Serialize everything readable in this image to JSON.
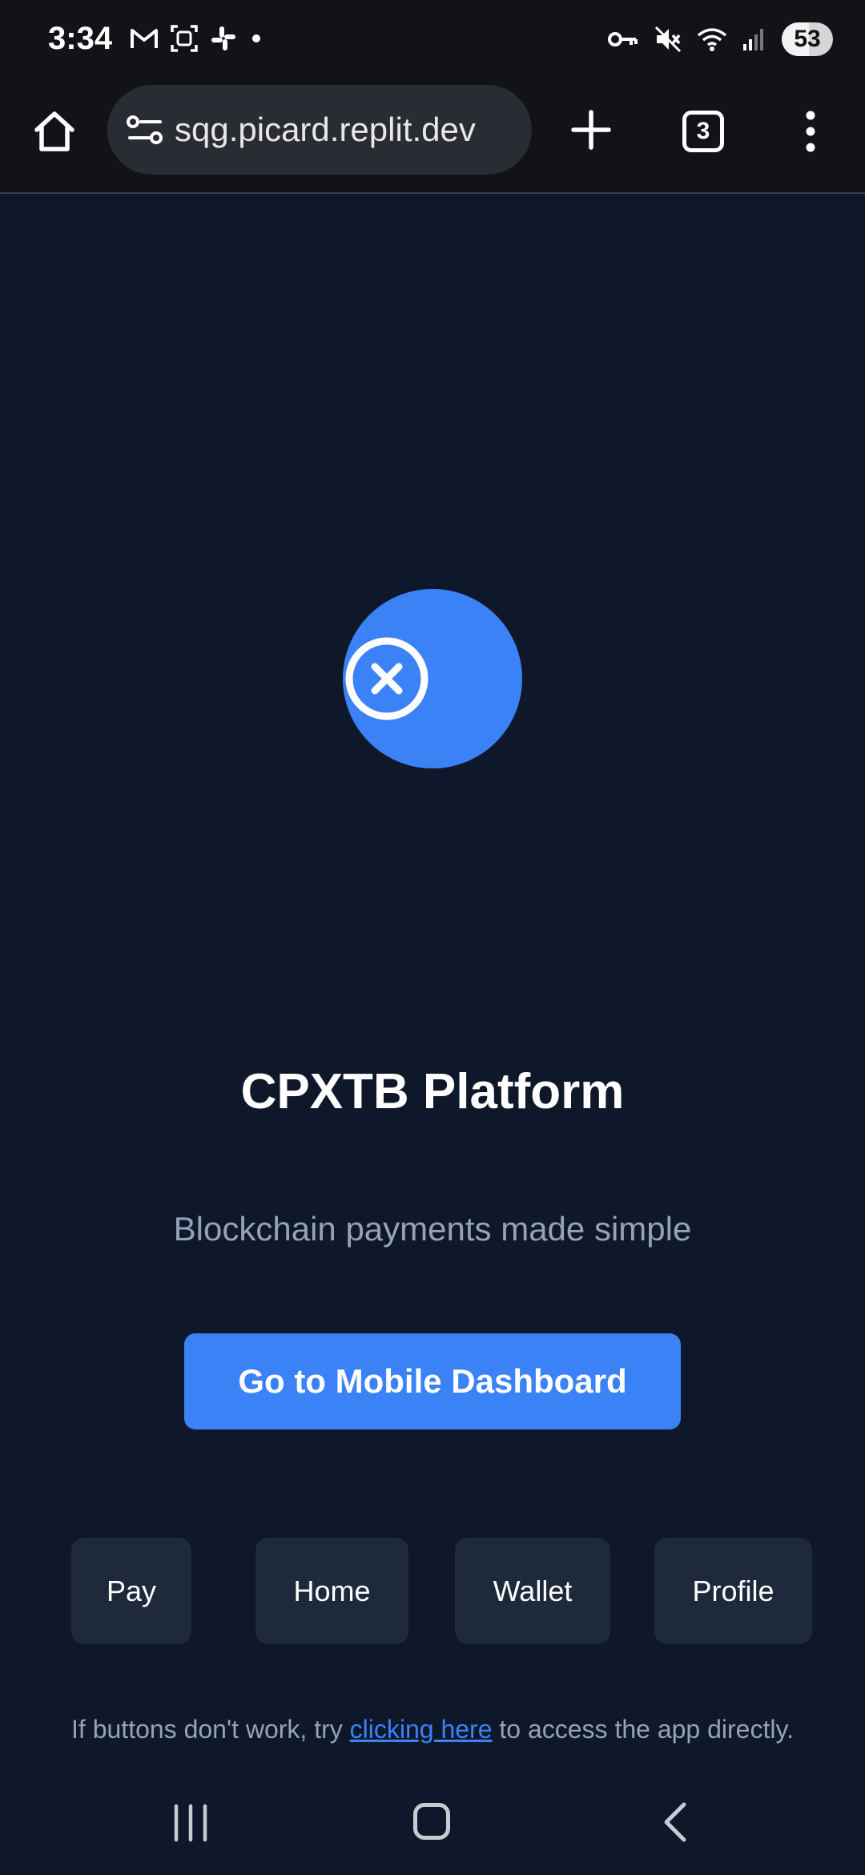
{
  "status_bar": {
    "time": "3:34",
    "battery": "53",
    "left_icons": [
      "gmail-icon",
      "screenshot-icon",
      "slack-icon",
      "dot-icon"
    ],
    "right_icons": [
      "vpn-key-icon",
      "mute-icon",
      "wifi-icon",
      "signal-icon"
    ]
  },
  "browser": {
    "url": "sqg.picard.replit.dev",
    "tab_count": "3"
  },
  "page": {
    "title": "CPXTB Platform",
    "subtitle": "Blockchain payments made simple",
    "cta_label": "Go to Mobile Dashboard",
    "nav_buttons": [
      {
        "label": "Pay"
      },
      {
        "label": "Home"
      },
      {
        "label": "Wallet"
      },
      {
        "label": "Profile"
      }
    ],
    "footer": {
      "before": "If buttons don't work, try ",
      "link": "clicking here",
      "after": " to access the app directly."
    }
  },
  "colors": {
    "background": "#0f172a",
    "accent": "#3b82f6",
    "button_dark": "#1e293b",
    "muted_text": "#94a3b8"
  }
}
